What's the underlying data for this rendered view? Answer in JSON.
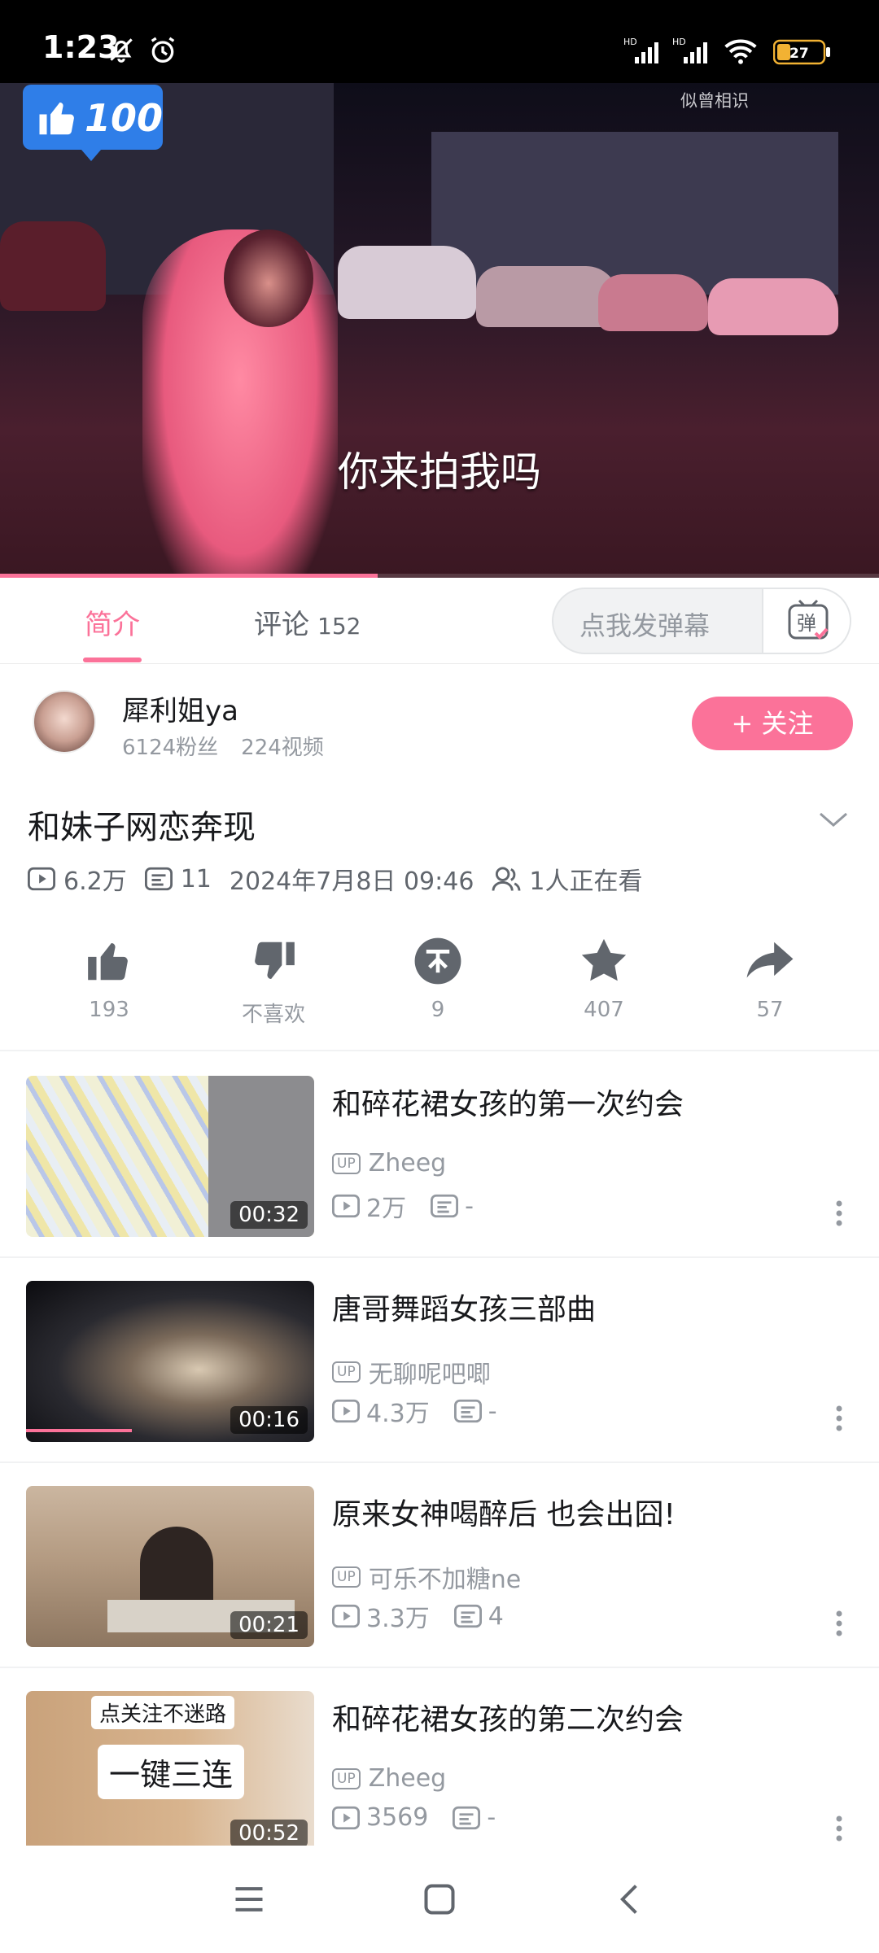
{
  "status_bar": {
    "time": "1:23",
    "battery": "27",
    "icons": [
      "bell-off-icon",
      "alarm-icon",
      "hd-signal-icon",
      "hd-signal-icon",
      "wifi-icon",
      "battery-icon"
    ]
  },
  "video": {
    "subtitle": "你来拍我吗",
    "watermark": "似曾相识",
    "like_badge": "100",
    "progress_percent": 43,
    "accent_color": "#fb7299"
  },
  "tabs": {
    "intro": "简介",
    "comments": "评论",
    "comments_count": "152",
    "danmaku_placeholder": "点我发弹幕",
    "danmaku_button": "弹"
  },
  "uploader": {
    "name": "犀利姐ya",
    "fans": "6124粉丝",
    "videos": "224视频",
    "follow_label": "+ 关注"
  },
  "video_info": {
    "title": "和妹子网恋奔现",
    "views": "6.2万",
    "danmaku": "11",
    "date": "2024年7月8日 09:46",
    "watching": "1人正在看"
  },
  "actions": {
    "like": "193",
    "dislike": "不喜欢",
    "coin": "9",
    "favorite": "407",
    "share": "57"
  },
  "recommendations": [
    {
      "title": "和碎花裙女孩的第一次约会",
      "up": "Zheeg",
      "views": "2万",
      "danmaku": "-",
      "duration": "00:32",
      "up_badge": "UP"
    },
    {
      "title": "唐哥舞蹈女孩三部曲",
      "up": "无聊呢吧唧",
      "views": "4.3万",
      "danmaku": "-",
      "duration": "00:16",
      "up_badge": "UP"
    },
    {
      "title": "原来女神喝醉后 也会出囧!",
      "up": "可乐不加糖ne",
      "views": "3.3万",
      "danmaku": "4",
      "duration": "00:21",
      "up_badge": "UP"
    },
    {
      "title": "和碎花裙女孩的第二次约会",
      "up": "Zheeg",
      "views": "3569",
      "danmaku": "-",
      "duration": "00:52",
      "up_badge": "UP",
      "thumb_text_1": "点关注不迷路",
      "thumb_text_2": "一键三连"
    }
  ]
}
